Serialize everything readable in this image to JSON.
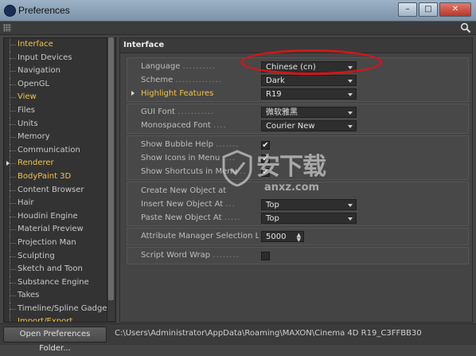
{
  "window": {
    "title": "Preferences"
  },
  "sidebar": {
    "items": [
      {
        "label": "Interface",
        "style": "active"
      },
      {
        "label": "Input Devices",
        "style": ""
      },
      {
        "label": "Navigation",
        "style": ""
      },
      {
        "label": "OpenGL",
        "style": ""
      },
      {
        "label": "View",
        "style": "yellow"
      },
      {
        "label": "Files",
        "style": ""
      },
      {
        "label": "Units",
        "style": ""
      },
      {
        "label": "Memory",
        "style": ""
      },
      {
        "label": "Communication",
        "style": ""
      },
      {
        "label": "Renderer",
        "style": "yellow expand"
      },
      {
        "label": "BodyPaint 3D",
        "style": "yellow"
      },
      {
        "label": "Content Browser",
        "style": ""
      },
      {
        "label": "Hair",
        "style": ""
      },
      {
        "label": "Houdini Engine",
        "style": ""
      },
      {
        "label": "Material Preview",
        "style": ""
      },
      {
        "label": "Projection Man",
        "style": ""
      },
      {
        "label": "Sculpting",
        "style": ""
      },
      {
        "label": "Sketch and Toon",
        "style": ""
      },
      {
        "label": "Substance Engine",
        "style": ""
      },
      {
        "label": "Takes",
        "style": ""
      },
      {
        "label": "Timeline/Spline Gadget",
        "style": ""
      },
      {
        "label": "Import/Export",
        "style": "yellow"
      }
    ]
  },
  "main": {
    "header": "Interface",
    "language": {
      "label": "Language",
      "value": "Chinese (cn)"
    },
    "scheme": {
      "label": "Scheme",
      "value": "Dark"
    },
    "highlight": {
      "label": "Highlight Features",
      "value": "R19"
    },
    "gui_font": {
      "label": "GUI Font",
      "value": "微软雅黑"
    },
    "mono_font": {
      "label": "Monospaced Font",
      "value": "Courier New"
    },
    "bubble_help": {
      "label": "Show Bubble Help",
      "checked": "✔"
    },
    "icons_menu": {
      "label": "Show Icons in Menu",
      "checked": "✔"
    },
    "shortcuts_menu": {
      "label": "Show Shortcuts in Menu",
      "checked": "✔"
    },
    "create_new": {
      "label": "Create New Object at"
    },
    "insert_new": {
      "label": "Insert New Object At",
      "value": "Top"
    },
    "paste_new": {
      "label": "Paste New Object At",
      "value": "Top"
    },
    "attr_limit": {
      "label": "Attribute Manager Selection Limit",
      "value": "5000"
    },
    "word_wrap": {
      "label": "Script Word Wrap",
      "checked": ""
    }
  },
  "watermark": {
    "main": "安下载",
    "sub": "anxz.com"
  },
  "footer": {
    "open_button": "Open Preferences Folder...",
    "path": "C:\\Users\\Administrator\\AppData\\Roaming\\MAXON\\Cinema 4D R19_C3FFBB30"
  }
}
